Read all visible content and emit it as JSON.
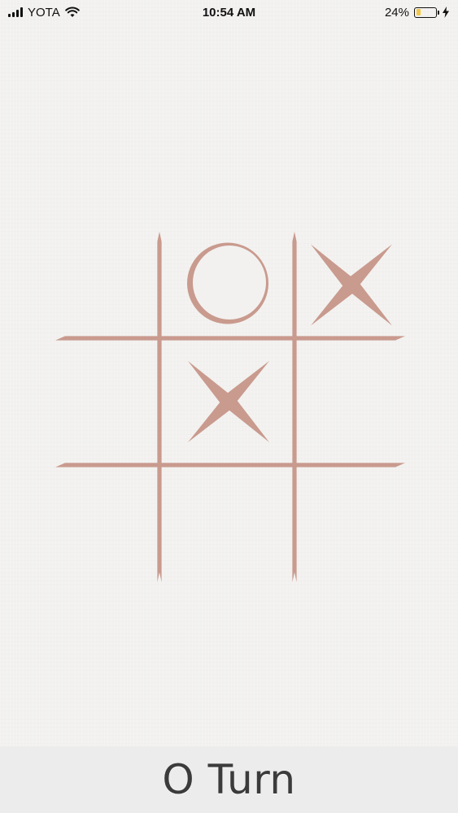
{
  "status_bar": {
    "carrier": "YOTA",
    "time": "10:54 AM",
    "battery_percent_text": "24%",
    "battery_level": 0.24,
    "battery_fill_color": "#f2c744",
    "icons": [
      "signal-icon",
      "wifi-icon",
      "battery-icon",
      "charging-bolt-icon"
    ]
  },
  "game": {
    "board": [
      [
        "",
        "O",
        "X"
      ],
      [
        "",
        "X",
        ""
      ],
      [
        "",
        "",
        ""
      ]
    ],
    "mark_color": "#c99a8e"
  },
  "footer": {
    "turn_text": "O Turn"
  }
}
